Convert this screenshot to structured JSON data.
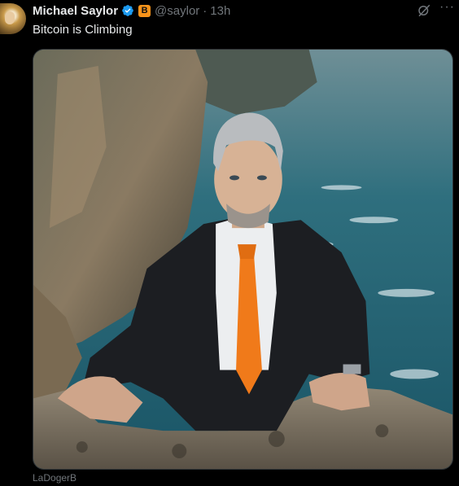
{
  "post": {
    "author_name": "Michael Saylor",
    "handle": "@saylor",
    "time": "13h",
    "separator": "·",
    "verified_icon": "verified-badge-icon",
    "org_badge_icon": "bitcoin-b-icon",
    "org_badge_letter": "B",
    "text": "Bitcoin is Climbing",
    "media_description_icon": "photo",
    "image_credit": "LaDogerB"
  },
  "actions": {
    "grok_icon": "grok-icon",
    "more_icon": "more-options-icon",
    "more_glyph": "···"
  },
  "colors": {
    "background": "#000000",
    "text_primary": "#e7e9ea",
    "text_secondary": "#71767b",
    "verified_blue": "#1d9bf0",
    "badge_orange": "#f7931a"
  }
}
